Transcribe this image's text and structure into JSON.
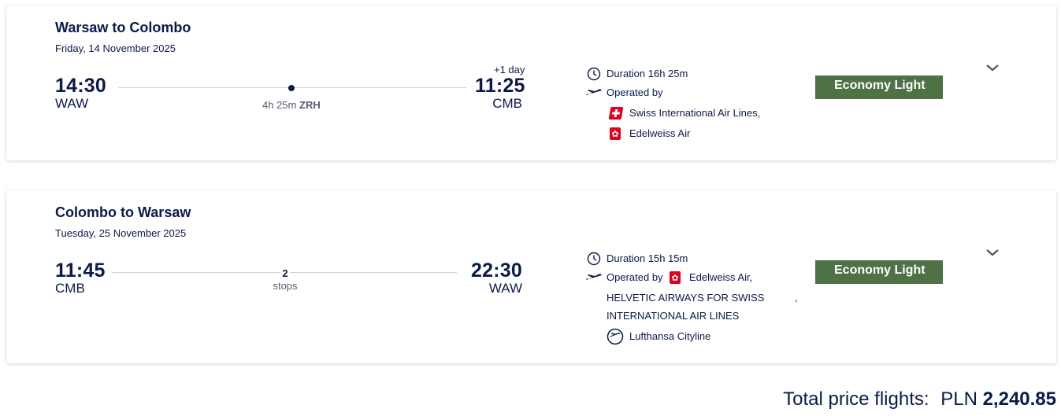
{
  "outbound": {
    "title": "Warsaw to Colombo",
    "date": "Friday, 14 November 2025",
    "dep_time": "14:30",
    "dep_code": "WAW",
    "arr_time": "11:25",
    "arr_code": "CMB",
    "day_offset": "+1 day",
    "layover_duration": "4h 25m",
    "layover_airport": "ZRH",
    "duration": "Duration 16h 25m",
    "operated_label": "Operated by",
    "carriers": [
      "Swiss International Air Lines,",
      "Edelweiss Air"
    ],
    "fare": "Economy Light"
  },
  "inbound": {
    "title": "Colombo to Warsaw",
    "date": "Tuesday, 25 November 2025",
    "dep_time": "11:45",
    "dep_code": "CMB",
    "arr_time": "22:30",
    "arr_code": "WAW",
    "stops_count": "2",
    "stops_label": "stops",
    "duration": "Duration 15h 15m",
    "operated_label": "Operated by",
    "carriers": [
      "Edelweiss Air,",
      "HELVETIC AIRWAYS FOR SWISS",
      "INTERNATIONAL AIR LINES",
      ",",
      "Lufthansa Cityline"
    ],
    "fare": "Economy Light"
  },
  "total": {
    "label": "Total price flights:",
    "currency": "PLN",
    "amount": "2,240.85"
  },
  "colors": {
    "navy": "#0b1a4a",
    "fare_green": "#4e7245",
    "swiss_red": "#e2001a"
  },
  "icons": [
    "clock-icon",
    "plane-icon",
    "swiss-logo-icon",
    "edelweiss-logo-icon",
    "lufthansa-logo-icon",
    "chevron-down-icon"
  ]
}
